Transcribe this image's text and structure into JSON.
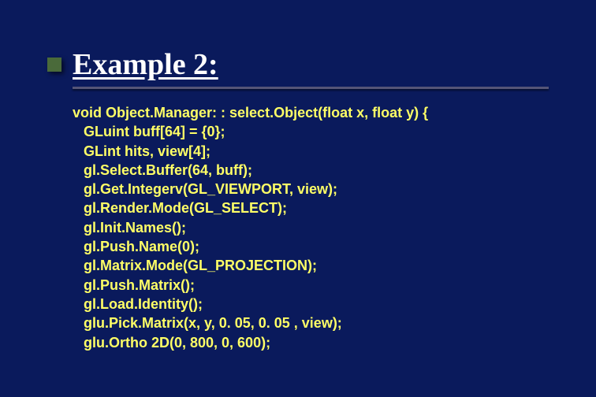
{
  "title": "Example 2:",
  "code": {
    "l0": "void Object.Manager: : select.Object(float x, float y) {",
    "l1": "GLuint buff[64] = {0};",
    "l2": "GLint hits, view[4];",
    "l3": "gl.Select.Buffer(64, buff);",
    "l4": "gl.Get.Integerv(GL_VIEWPORT, view);",
    "l5": "gl.Render.Mode(GL_SELECT);",
    "l6": "gl.Init.Names();",
    "l7": "gl.Push.Name(0);",
    "l8": "gl.Matrix.Mode(GL_PROJECTION);",
    "l9": "gl.Push.Matrix();",
    "l10": "gl.Load.Identity();",
    "l11": "glu.Pick.Matrix(x, y, 0. 05, 0. 05 , view);",
    "l12": "glu.Ortho 2D(0, 800, 0, 600);"
  }
}
